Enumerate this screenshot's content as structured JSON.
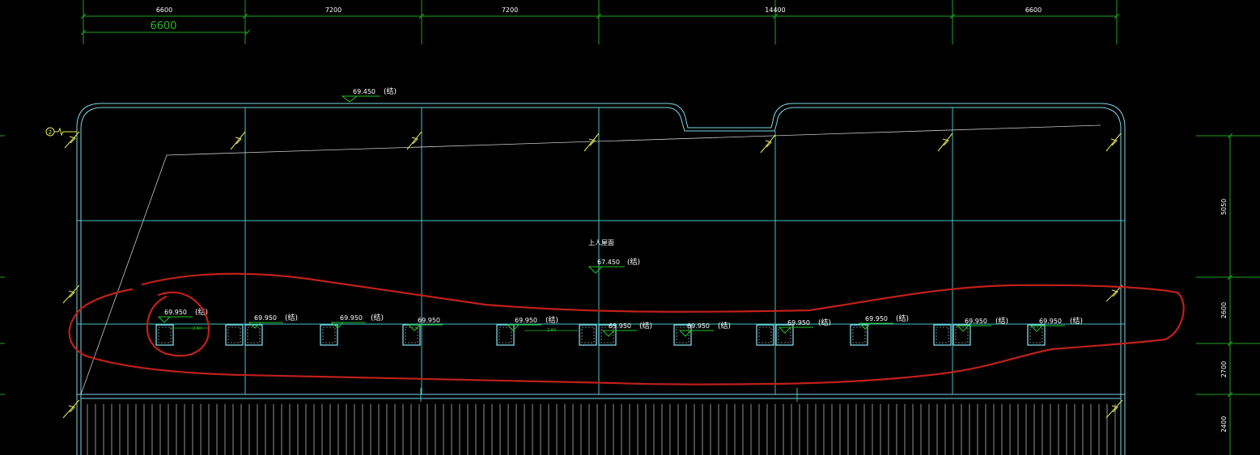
{
  "colors": {
    "background": "#000000",
    "dimension_line": "#1fa51f",
    "grid_line": "#3ec8c8",
    "outline": "#7fd6e6",
    "level_mark": "#22c422",
    "text": "#ffffff",
    "markup": "#c0201a",
    "arrow": "#e8e85a"
  },
  "top_dimensions": [
    "6600",
    "7200",
    "7200",
    "14400",
    "6600"
  ],
  "sub_dimension": "6600",
  "right_dimensions": [
    "5050",
    "2600",
    "2700",
    "2400"
  ],
  "roof_label": "上人屋面",
  "axis_bubble": "2",
  "levels": {
    "parapet": {
      "value": "69.450",
      "tag": "(结)"
    },
    "roof": {
      "value": "67.450",
      "tag": "(结)"
    },
    "openings": [
      {
        "value": "69.950",
        "tag": "(结)"
      },
      {
        "value": "69.950",
        "tag": "(结)"
      },
      {
        "value": "69.950",
        "tag": "(结)"
      },
      {
        "value": "69.950",
        "tag": ""
      },
      {
        "value": "69.950",
        "tag": "(结)"
      },
      {
        "value": "69.950",
        "tag": "(结)"
      },
      {
        "value": "69.950",
        "tag": "(结)"
      },
      {
        "value": "69.950",
        "tag": "(结)"
      },
      {
        "value": "69.950",
        "tag": "(结)"
      },
      {
        "value": "69.950",
        "tag": "(结)"
      },
      {
        "value": "69.950",
        "tag": "(结)"
      }
    ]
  },
  "small_notes": [
    "2.60",
    "2.60"
  ]
}
